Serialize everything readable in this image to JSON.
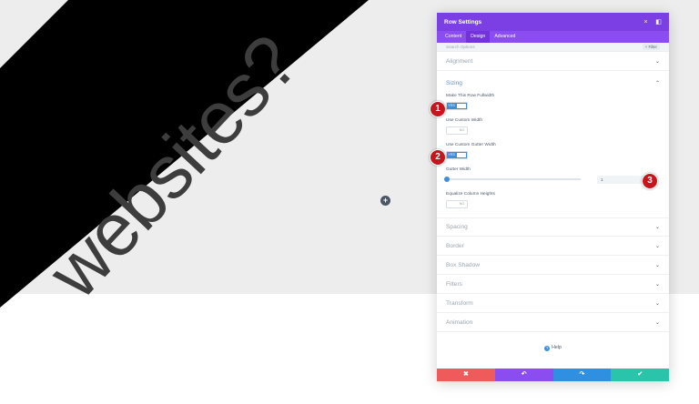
{
  "background": {
    "word": "websites?",
    "colors": {
      "gray": "#ededed",
      "black": "#000000",
      "text": "#3d3d3d"
    }
  },
  "add_button": {
    "glyph": "+"
  },
  "modal": {
    "title": "Row Settings",
    "header_icons": {
      "close": "×",
      "expand": "◧"
    },
    "tabs": [
      {
        "label": "Content",
        "active": false
      },
      {
        "label": "Design",
        "active": true
      },
      {
        "label": "Advanced",
        "active": false
      }
    ],
    "search": {
      "placeholder": "Search Options",
      "filter_label": "+ Filter"
    },
    "sections_top": [
      {
        "label": "Alignment"
      }
    ],
    "sizing": {
      "label": "Sizing",
      "options": {
        "fullwidth": {
          "label": "Make This Row Fullwidth",
          "toggle": "YES"
        },
        "custom_width": {
          "label": "Use Custom Width",
          "toggle": "NO"
        },
        "custom_gutter": {
          "label": "Use Custom Gutter Width",
          "toggle": "YES"
        },
        "gutter_width": {
          "label": "Gutter Width",
          "value": "1"
        },
        "equalize": {
          "label": "Equalize Column Heights",
          "toggle": "NO"
        }
      }
    },
    "sections_bottom": [
      {
        "label": "Spacing"
      },
      {
        "label": "Border"
      },
      {
        "label": "Box Shadow"
      },
      {
        "label": "Filters"
      },
      {
        "label": "Transform"
      },
      {
        "label": "Animation"
      }
    ],
    "help": {
      "label": "Help",
      "icon": "?"
    },
    "footer": {
      "cancel": {
        "glyph": "✖",
        "color": "#ef5b5b"
      },
      "undo": {
        "glyph": "↶",
        "color": "#8b4cf0"
      },
      "redo": {
        "glyph": "↷",
        "color": "#2f8fe0"
      },
      "save": {
        "glyph": "✔",
        "color": "#29c4a9"
      }
    },
    "colors": {
      "header": "#7b3fe4",
      "tabs": "#8b4cf0",
      "accent": "#3f8fd8"
    }
  },
  "markers": [
    "1",
    "2",
    "3"
  ]
}
